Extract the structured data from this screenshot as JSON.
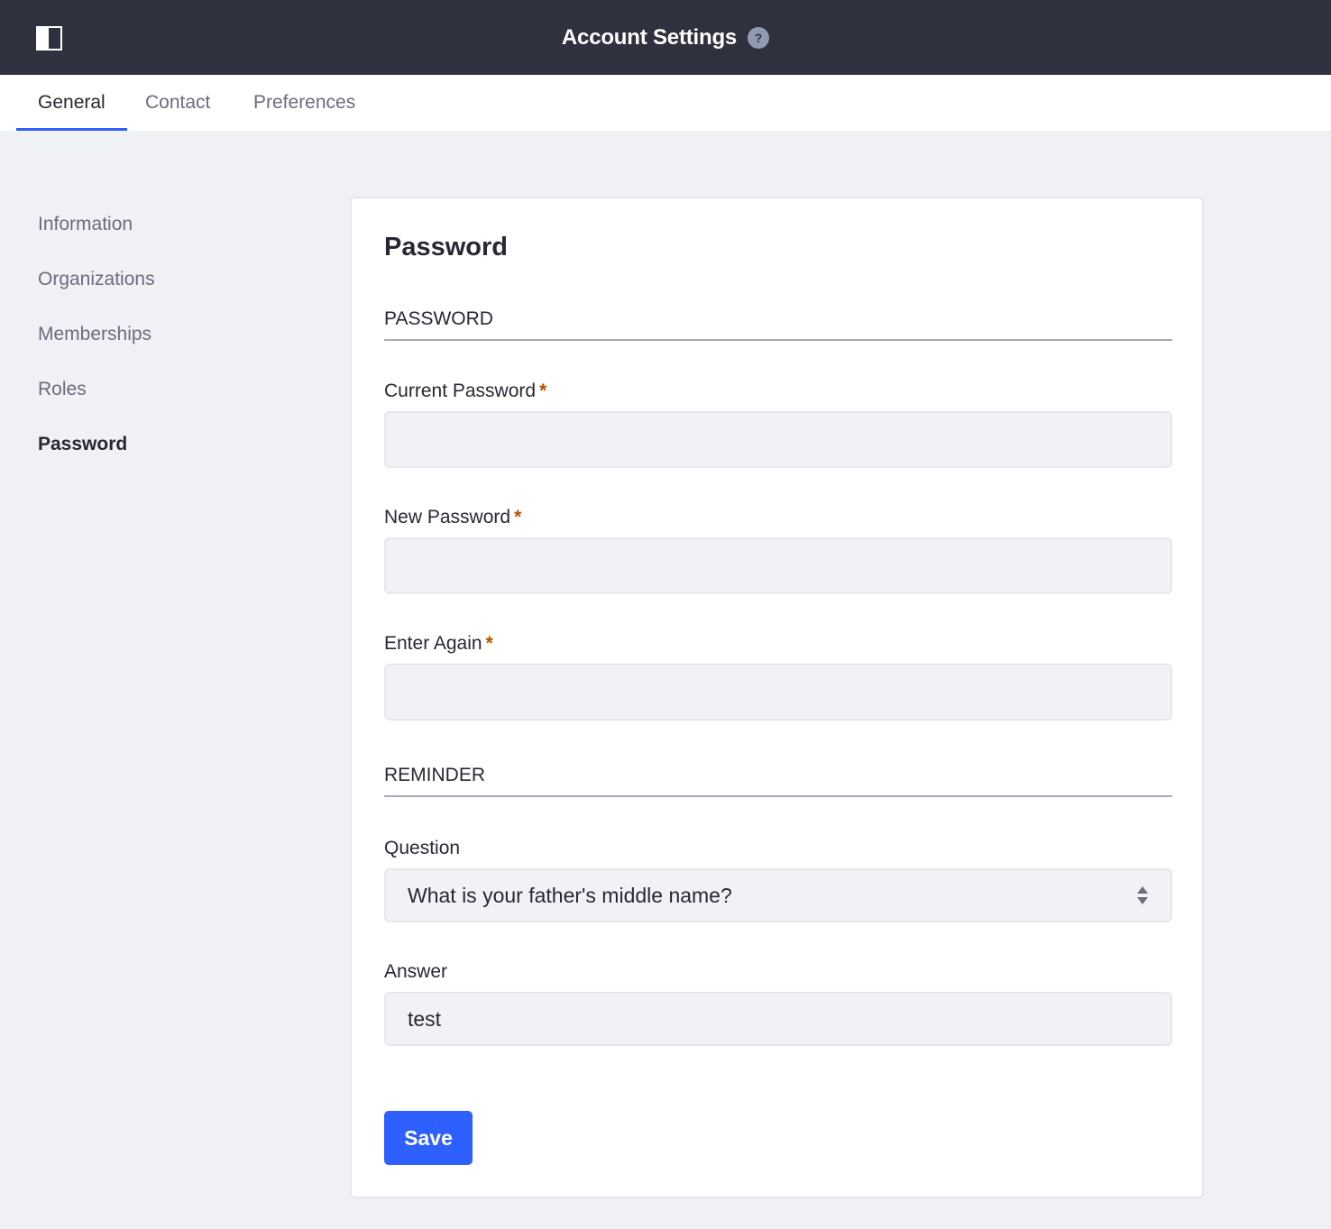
{
  "header": {
    "title": "Account Settings",
    "help_icon": "question-circle-icon",
    "help_symbol": "?",
    "panel_toggle_icon": "sidebar-panel-icon"
  },
  "tabs": [
    {
      "label": "General",
      "active": true
    },
    {
      "label": "Contact",
      "active": false
    },
    {
      "label": "Preferences",
      "active": false
    }
  ],
  "sidenav": {
    "items": [
      {
        "label": "Information",
        "active": false
      },
      {
        "label": "Organizations",
        "active": false
      },
      {
        "label": "Memberships",
        "active": false
      },
      {
        "label": "Roles",
        "active": false
      },
      {
        "label": "Password",
        "active": true
      }
    ]
  },
  "card": {
    "title": "Password",
    "password_section": {
      "heading": "PASSWORD",
      "current_password": {
        "label": "Current Password",
        "required_mark": "*",
        "value": ""
      },
      "new_password": {
        "label": "New Password",
        "required_mark": "*",
        "value": ""
      },
      "enter_again": {
        "label": "Enter Again",
        "required_mark": "*",
        "value": ""
      }
    },
    "reminder_section": {
      "heading": "REMINDER",
      "question": {
        "label": "Question",
        "selected": "What is your father's middle name?",
        "icon": "select-arrows-icon"
      },
      "answer": {
        "label": "Answer",
        "value": "test"
      }
    },
    "save_label": "Save"
  },
  "colors": {
    "topbar": "#30313f",
    "accent": "#2e5fff",
    "required": "#b95000",
    "page_bg": "#f0f1f5"
  }
}
